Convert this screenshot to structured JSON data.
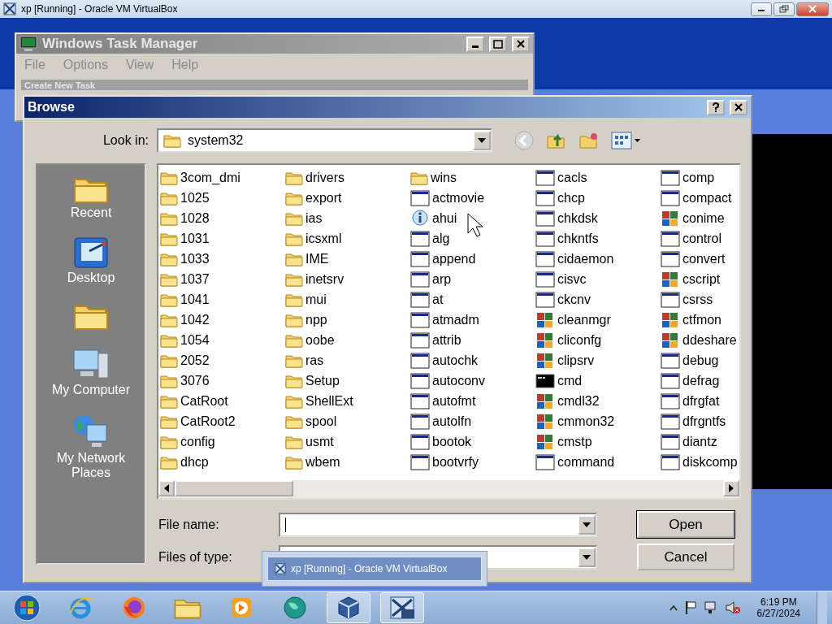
{
  "host_window": {
    "title": "xp [Running] - Oracle VM VirtualBox"
  },
  "task_manager": {
    "title": "Windows Task Manager",
    "menu": [
      "File",
      "Options",
      "View",
      "Help"
    ],
    "child_title": "Create New Task"
  },
  "browse_dialog": {
    "title": "Browse",
    "look_in_label": "Look in:",
    "look_in_value": "system32",
    "places": [
      {
        "kind": "recent",
        "label": "Recent"
      },
      {
        "kind": "desktop",
        "label": "Desktop"
      },
      {
        "kind": "folder"
      },
      {
        "kind": "computer",
        "label": "My Computer"
      },
      {
        "kind": "network",
        "label": "My Network Places"
      }
    ],
    "files": [
      {
        "name": "3com_dmi",
        "kind": "folder"
      },
      {
        "name": "1025",
        "kind": "folder"
      },
      {
        "name": "1028",
        "kind": "folder"
      },
      {
        "name": "1031",
        "kind": "folder"
      },
      {
        "name": "1033",
        "kind": "folder"
      },
      {
        "name": "1037",
        "kind": "folder"
      },
      {
        "name": "1041",
        "kind": "folder"
      },
      {
        "name": "1042",
        "kind": "folder"
      },
      {
        "name": "1054",
        "kind": "folder"
      },
      {
        "name": "2052",
        "kind": "folder"
      },
      {
        "name": "3076",
        "kind": "folder"
      },
      {
        "name": "CatRoot",
        "kind": "folder"
      },
      {
        "name": "CatRoot2",
        "kind": "folder"
      },
      {
        "name": "config",
        "kind": "folder"
      },
      {
        "name": "dhcp",
        "kind": "folder"
      },
      {
        "name": "drivers",
        "kind": "folder"
      },
      {
        "name": "export",
        "kind": "folder"
      },
      {
        "name": "ias",
        "kind": "folder"
      },
      {
        "name": "icsxml",
        "kind": "folder"
      },
      {
        "name": "IME",
        "kind": "folder"
      },
      {
        "name": "inetsrv",
        "kind": "folder"
      },
      {
        "name": "mui",
        "kind": "folder"
      },
      {
        "name": "npp",
        "kind": "folder"
      },
      {
        "name": "oobe",
        "kind": "folder"
      },
      {
        "name": "ras",
        "kind": "folder"
      },
      {
        "name": "Setup",
        "kind": "folder"
      },
      {
        "name": "ShellExt",
        "kind": "folder"
      },
      {
        "name": "spool",
        "kind": "folder"
      },
      {
        "name": "usmt",
        "kind": "folder"
      },
      {
        "name": "wbem",
        "kind": "folder"
      },
      {
        "name": "wins",
        "kind": "folder"
      },
      {
        "name": "actmovie",
        "kind": "program"
      },
      {
        "name": "ahui",
        "kind": "info"
      },
      {
        "name": "alg",
        "kind": "program"
      },
      {
        "name": "append",
        "kind": "program"
      },
      {
        "name": "arp",
        "kind": "program"
      },
      {
        "name": "at",
        "kind": "program"
      },
      {
        "name": "atmadm",
        "kind": "program"
      },
      {
        "name": "attrib",
        "kind": "program"
      },
      {
        "name": "autochk",
        "kind": "program"
      },
      {
        "name": "autoconv",
        "kind": "program"
      },
      {
        "name": "autofmt",
        "kind": "program"
      },
      {
        "name": "autolfn",
        "kind": "program"
      },
      {
        "name": "bootok",
        "kind": "program"
      },
      {
        "name": "bootvrfy",
        "kind": "program"
      },
      {
        "name": "cacls",
        "kind": "program"
      },
      {
        "name": "chcp",
        "kind": "program"
      },
      {
        "name": "chkdsk",
        "kind": "program"
      },
      {
        "name": "chkntfs",
        "kind": "program"
      },
      {
        "name": "cidaemon",
        "kind": "program"
      },
      {
        "name": "cisvc",
        "kind": "program"
      },
      {
        "name": "ckcnv",
        "kind": "program"
      },
      {
        "name": "cleanmgr",
        "kind": "tool"
      },
      {
        "name": "cliconfg",
        "kind": "tool"
      },
      {
        "name": "clipsrv",
        "kind": "tool"
      },
      {
        "name": "cmd",
        "kind": "console"
      },
      {
        "name": "cmdl32",
        "kind": "tool"
      },
      {
        "name": "cmmon32",
        "kind": "tool"
      },
      {
        "name": "cmstp",
        "kind": "tool"
      },
      {
        "name": "command",
        "kind": "program"
      },
      {
        "name": "comp",
        "kind": "program"
      },
      {
        "name": "compact",
        "kind": "program"
      },
      {
        "name": "conime",
        "kind": "tool"
      },
      {
        "name": "control",
        "kind": "program"
      },
      {
        "name": "convert",
        "kind": "program"
      },
      {
        "name": "cscript",
        "kind": "tool"
      },
      {
        "name": "csrss",
        "kind": "program"
      },
      {
        "name": "ctfmon",
        "kind": "tool"
      },
      {
        "name": "ddeshare",
        "kind": "tool"
      },
      {
        "name": "debug",
        "kind": "program"
      },
      {
        "name": "defrag",
        "kind": "program"
      },
      {
        "name": "dfrgfat",
        "kind": "program"
      },
      {
        "name": "dfrgntfs",
        "kind": "program"
      },
      {
        "name": "diantz",
        "kind": "program"
      },
      {
        "name": "diskcomp",
        "kind": "program"
      }
    ],
    "file_name_label": "File name:",
    "files_of_type_label": "Files of type:",
    "buttons": [
      "Open",
      "Cancel"
    ]
  },
  "tooltip": "xp [Running] - Oracle VM VirtualBox",
  "taskbar": {
    "apps": [
      {
        "kind": "start",
        "running": false
      },
      {
        "kind": "browser-e",
        "running": false
      },
      {
        "kind": "browser-fox",
        "running": false
      },
      {
        "kind": "folder",
        "running": false
      },
      {
        "kind": "media",
        "running": false
      },
      {
        "kind": "globe",
        "running": false
      },
      {
        "kind": "cube",
        "running": true
      },
      {
        "kind": "vm",
        "running": true
      }
    ],
    "time": "6:19 PM",
    "date": "6/27/2024"
  }
}
